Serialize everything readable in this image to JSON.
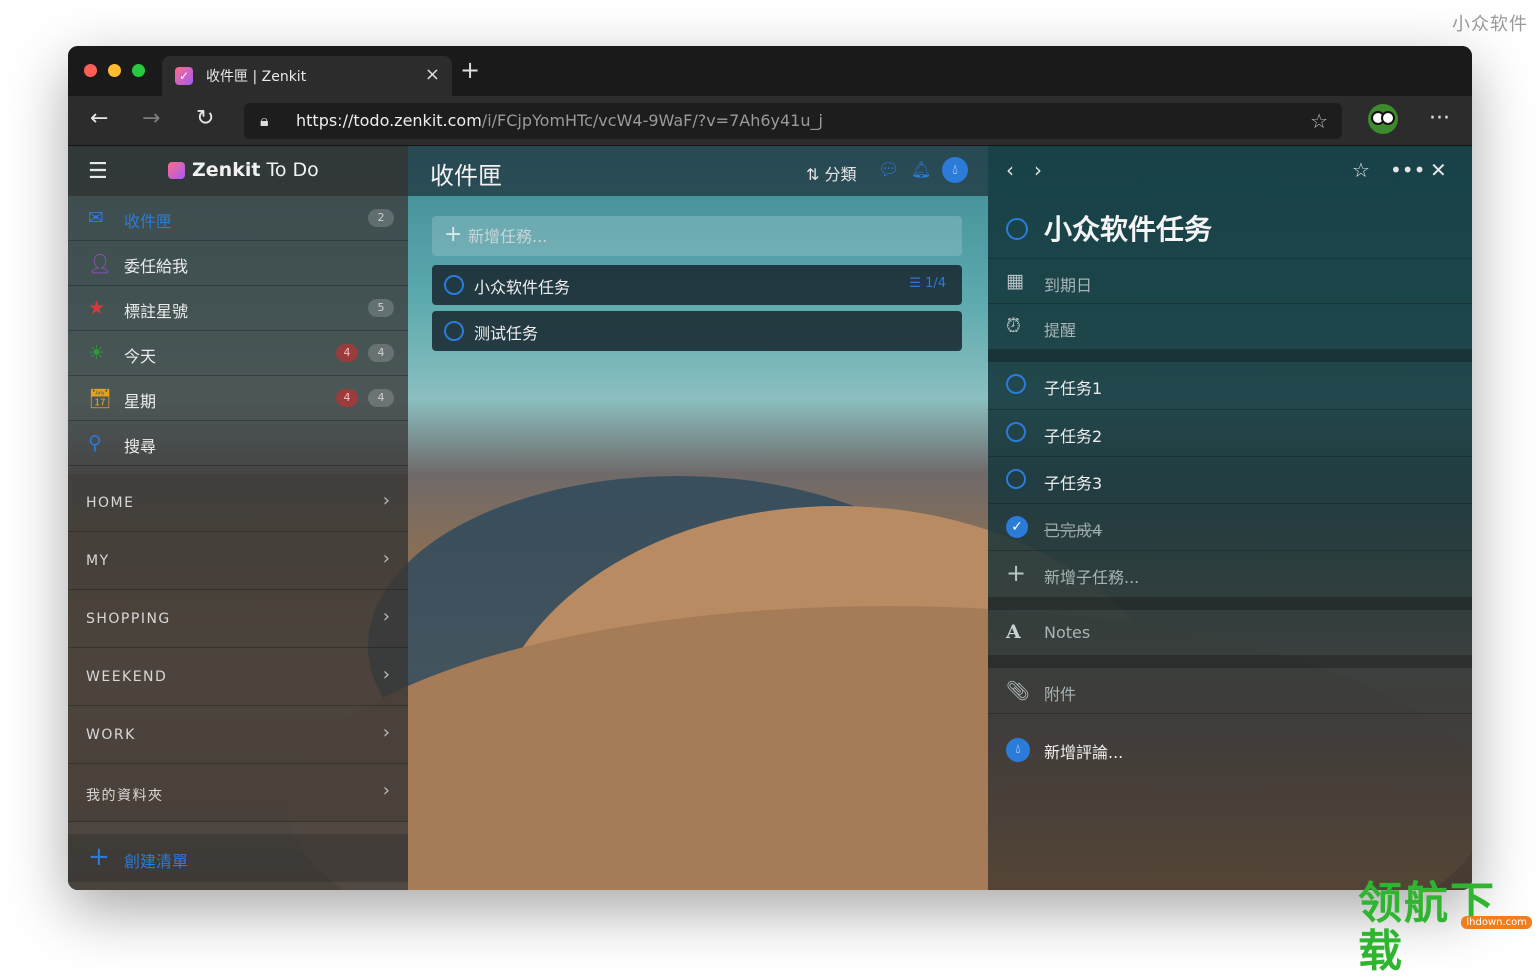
{
  "corner_brand": "小众软件",
  "watermark": {
    "text": "领航下载",
    "domain": "lhdown.com"
  },
  "browser": {
    "tab_title": "收件匣 | Zenkit",
    "url_host": "https://todo.zenkit.com",
    "url_path": "/i/FCjpYomHTc/vcW4-9WaF/?v=7Ah6y41u_j"
  },
  "app": {
    "name_bold": "Zenkit",
    "name_rest": " To Do"
  },
  "sidebar": {
    "items": [
      {
        "label": "收件匣",
        "count": "2"
      },
      {
        "label": "委任給我"
      },
      {
        "label": "標註星號",
        "count": "5"
      },
      {
        "label": "今天",
        "alert": "4",
        "count": "4"
      },
      {
        "label": "星期",
        "alert": "4",
        "count": "4"
      },
      {
        "label": "搜尋"
      }
    ],
    "groups": [
      "HOME",
      "MY",
      "SHOPPING",
      "WEEKEND",
      "WORK",
      "我的資料夾"
    ],
    "create_label": "創建清單"
  },
  "list": {
    "title": "收件匣",
    "sort_label": "分類",
    "new_task_placeholder": "新增任務...",
    "tasks": [
      {
        "label": "小众软件任务",
        "subtasks": "1/4"
      },
      {
        "label": "测试任务"
      }
    ]
  },
  "detail": {
    "title": "小众软件任务",
    "due_label": "到期日",
    "reminder_label": "提醒",
    "subtasks": [
      {
        "label": "子任务1",
        "done": false
      },
      {
        "label": "子任务2",
        "done": false
      },
      {
        "label": "子任务3",
        "done": false
      },
      {
        "label": "已完成4",
        "done": true
      }
    ],
    "new_subtask_placeholder": "新增子任務...",
    "notes_label": "Notes",
    "attachment_label": "附件",
    "comment_placeholder": "新增評論..."
  },
  "colors": {
    "accent": "#2b7bd8"
  }
}
